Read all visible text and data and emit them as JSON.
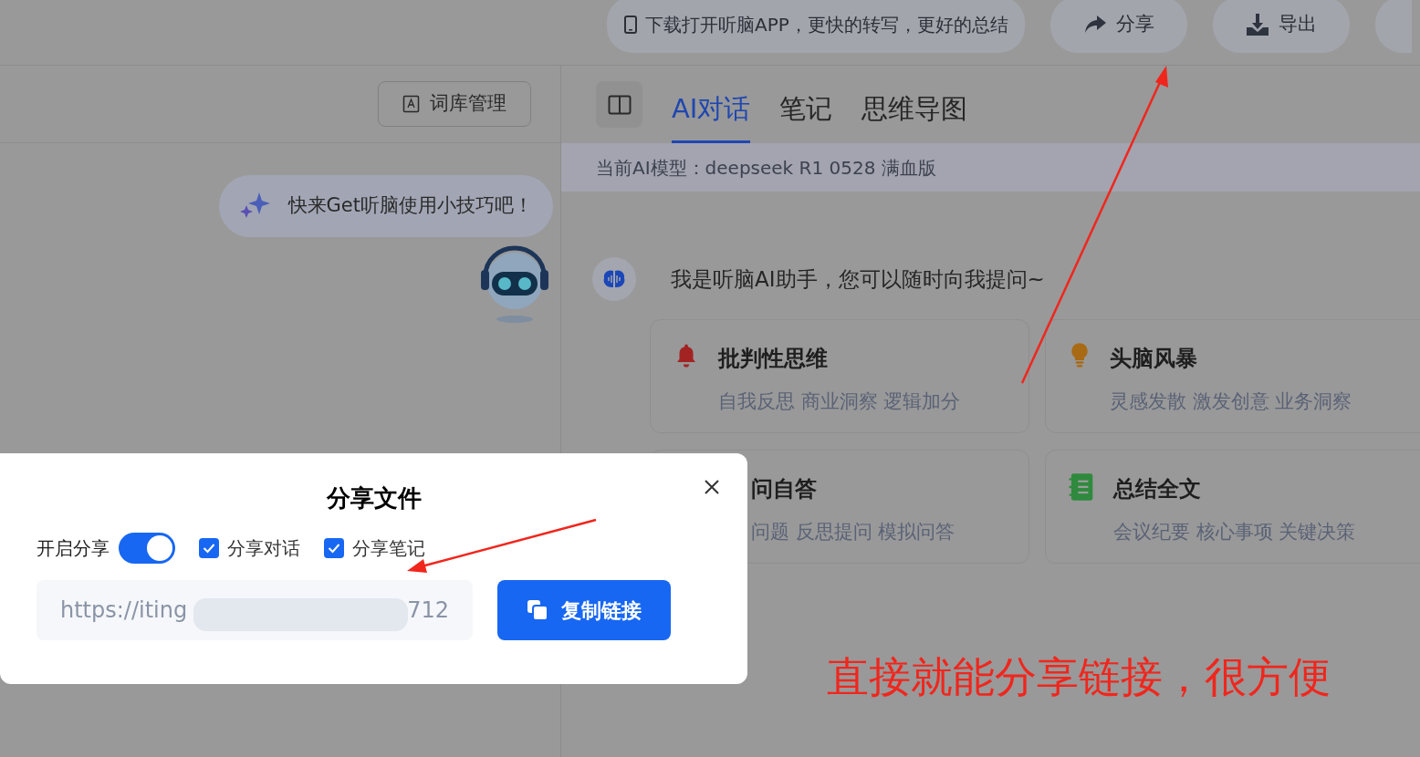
{
  "top_bar": {
    "download_banner": "下载打开听脑APP，更快的转写，更好的总结",
    "buttons": [
      {
        "label": "分享",
        "kind": "share"
      },
      {
        "label": "导出",
        "kind": "export"
      }
    ]
  },
  "left_panel": {
    "lexicon_button": "词库管理",
    "tip_bubble": "快来Get听脑使用小技巧吧！"
  },
  "right_panel": {
    "tabs": [
      {
        "label": "AI对话",
        "selected": true
      },
      {
        "label": "笔记",
        "selected": false
      },
      {
        "label": "思维导图",
        "selected": false
      }
    ],
    "model_bar": "当前AI模型：deepseek R1 0528 满血版",
    "assistant_greeting": "我是听脑AI助手，您可以随时向我提问~",
    "cards": [
      {
        "kind": "bell",
        "title": "批判性思维",
        "subtitle": "自我反思 商业洞察 逻辑加分"
      },
      {
        "kind": "bulb",
        "title": "头脑风暴",
        "subtitle": "灵感发散 激发创意 业务洞察"
      },
      {
        "kind": "covered",
        "title": "问自答",
        "subtitle": "问题 反思提问 模拟问答"
      },
      {
        "kind": "notebook",
        "title": "总结全文",
        "subtitle": "会议纪要 核心事项 关键决策"
      }
    ]
  },
  "share_dialog": {
    "title": "分享文件",
    "toggle": {
      "label": "开启分享",
      "on": true
    },
    "checkboxes": [
      {
        "label": "分享对话",
        "checked": true
      },
      {
        "label": "分享笔记",
        "checked": true
      }
    ],
    "link_field": {
      "value": "https://iting",
      "tail": "712"
    },
    "copy_button": "复制链接"
  },
  "annotation": {
    "text": "直接就能分享链接，很方便"
  }
}
